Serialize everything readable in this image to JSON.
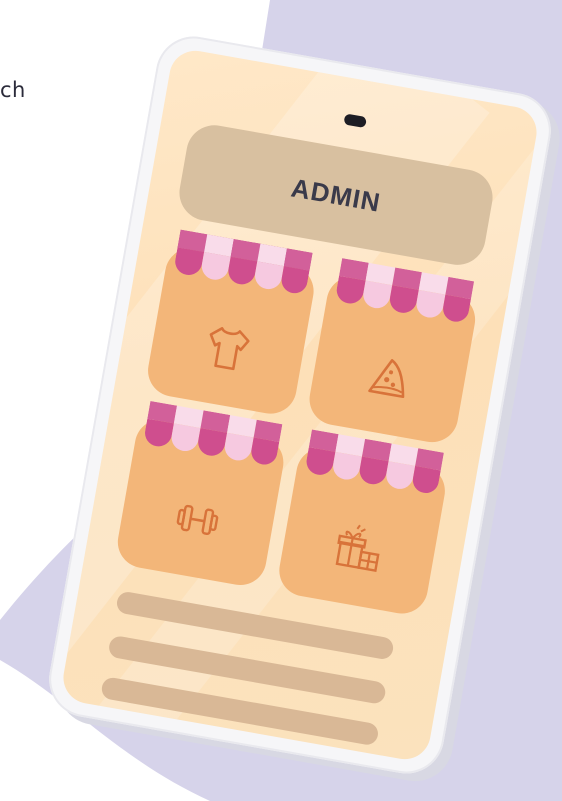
{
  "page": {
    "partial_text": "ch"
  },
  "phone": {
    "header_title": "ADMIN",
    "shops": [
      {
        "icon": "t-shirt-icon"
      },
      {
        "icon": "pizza-slice-icon"
      },
      {
        "icon": "dumbbell-icon"
      },
      {
        "icon": "gift-box-icon"
      }
    ]
  },
  "colors": {
    "background_blob": "#d6d3ea",
    "phone_frame": "#f6f6f8",
    "screen": "#fde3bf",
    "admin_bar": "#d8c0a0",
    "admin_text": "#3a3a4a",
    "shop_card": "#f3b679",
    "icon_stroke": "#d8733a",
    "awning_dark": "#cf4e8e",
    "awning_light": "#f6c9e0",
    "placeholder_line": "#d9b896"
  }
}
